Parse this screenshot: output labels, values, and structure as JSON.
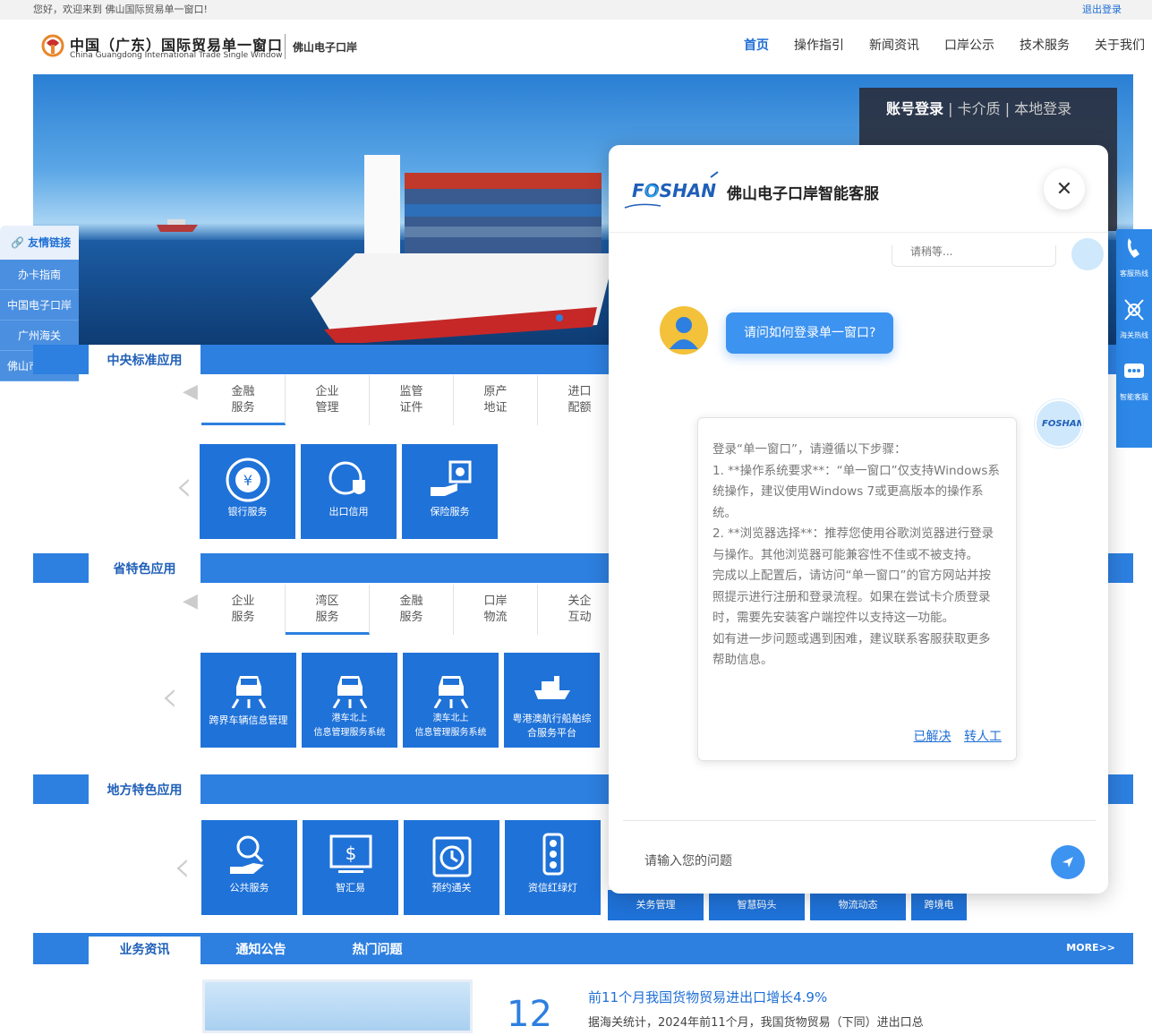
{
  "topbar": {
    "welcome": "您好，欢迎来到 佛山国际贸易单一窗口!",
    "logout": "退出登录"
  },
  "header": {
    "brand_cn": "中国（广东）国际贸易单一窗口",
    "brand_en": "China Guangdong International Trade Single Window",
    "brand_sub": "佛山电子口岸",
    "nav": [
      "首页",
      "操作指引",
      "新闻资讯",
      "口岸公示",
      "技术服务",
      "关于我们"
    ]
  },
  "login": {
    "tab1": "账号登录",
    "tab2": "| 卡介质",
    "tab3": "| 本地登录"
  },
  "friend_links": {
    "title": "友情链接",
    "items": [
      "办卡指南",
      "中国电子口岸",
      "广州海关",
      "佛山市商务局"
    ]
  },
  "sections": {
    "central": {
      "title": "中央标准应用",
      "tabs": [
        [
          "金融",
          "服务"
        ],
        [
          "企业",
          "管理"
        ],
        [
          "监管",
          "证件"
        ],
        [
          "原产",
          "地证"
        ],
        [
          "进口",
          "配额"
        ]
      ],
      "tiles": [
        "银行服务",
        "出口信用",
        "保险服务"
      ]
    },
    "province": {
      "title": "省特色应用",
      "tabs": [
        [
          "企业",
          "服务"
        ],
        [
          "湾区",
          "服务"
        ],
        [
          "金融",
          "服务"
        ],
        [
          "口岸",
          "物流"
        ],
        [
          "关企",
          "互动"
        ]
      ],
      "tiles": [
        [
          "跨界车辆信息管理",
          ""
        ],
        [
          "港车北上",
          "信息管理服务系统"
        ],
        [
          "澳车北上",
          "信息管理服务系统"
        ],
        [
          "粤港澳航行船舶综",
          "合服务平台"
        ]
      ]
    },
    "local": {
      "title": "地方特色应用",
      "tiles": [
        "公共服务",
        "智汇易",
        "预约通关",
        "资信红绿灯"
      ],
      "small_tiles": [
        "关务管理",
        "智慧码头",
        "物流动态",
        "跨境电"
      ]
    }
  },
  "news": {
    "tabs": [
      "业务资讯",
      "通知公告",
      "热门问题"
    ],
    "more": "MORE>>",
    "day": "12",
    "title": "前11个月我国货物贸易进出口增长4.9%",
    "desc": "据海关统计，2024年前11个月，我国货物贸易（下同）进出口总"
  },
  "right_float": [
    "客服热线",
    "海关热线",
    "智能客服"
  ],
  "chat": {
    "title": "佛山电子口岸智能客服",
    "prev_text": "请稍等...",
    "user_question": "请问如何登录单一窗口?",
    "answer": [
      "登录“单一窗口”，请遵循以下步骤：",
      "1. **操作系统要求**：“单一窗口”仅支持Windows系统操作，建议使用Windows 7或更高版本的操作系统。",
      "2. **浏览器选择**：推荐您使用谷歌浏览器进行登录与操作。其他浏览器可能兼容性不佳或不被支持。",
      "完成以上配置后，请访问“单一窗口”的官方网站并按照提示进行注册和登录流程。如果在尝试卡介质登录时，需要先安装客户端控件以支持这一功能。",
      "如有进一步问题或遇到困难，建议联系客服获取更多帮助信息。"
    ],
    "resolved": "已解决",
    "transfer": "转人工",
    "input_placeholder": "请输入您的问题"
  }
}
